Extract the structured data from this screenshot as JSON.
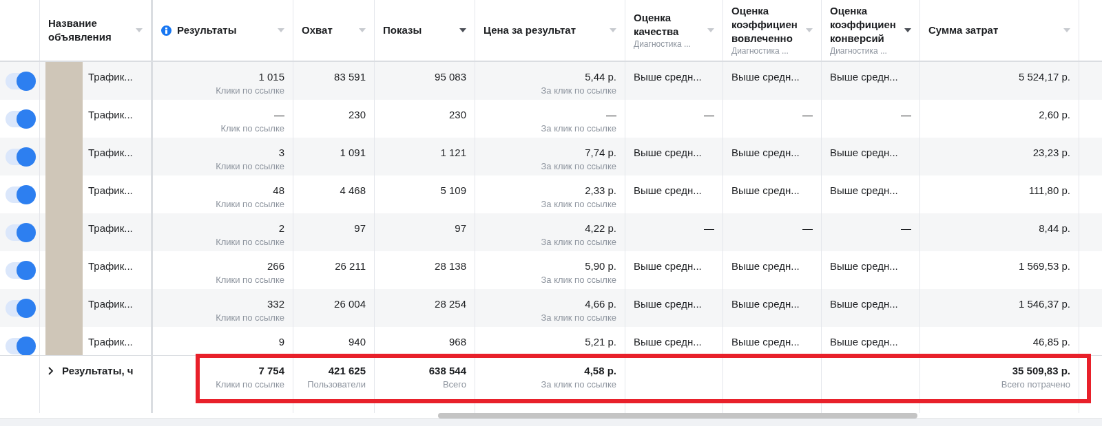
{
  "columns": [
    {
      "kind": "name",
      "title": "Название объявления",
      "sorted": false
    },
    {
      "kind": "results",
      "title": "Результаты",
      "info": true,
      "sorted": false
    },
    {
      "kind": "num",
      "title": "Охват",
      "sorted": false
    },
    {
      "kind": "num",
      "title": "Показы",
      "sorted": true
    },
    {
      "kind": "num",
      "title": "Цена за результат",
      "sorted": false
    },
    {
      "kind": "num",
      "title": "Оценка\nкачества",
      "subtitle": "Диагностика ...",
      "sorted": false
    },
    {
      "kind": "num",
      "title": "Оценка\nкоэффициен\nвовлеченно",
      "subtitle": "Диагностика ...",
      "sorted": false
    },
    {
      "kind": "num",
      "title": "Оценка\nкоэффициен\nконверсий",
      "subtitle": "Диагностика ...",
      "sorted": true
    },
    {
      "kind": "num",
      "title": "Сумма затрат",
      "sorted": false
    }
  ],
  "rows": [
    {
      "on": true,
      "name": "Трафик...",
      "results": {
        "value": "1 015",
        "label": "Клики по ссылке"
      },
      "reach": "83 591",
      "impressions": "95 083",
      "cpr": {
        "value": "5,44 р.",
        "label": "За клик по ссылке"
      },
      "quality": "Выше средн...",
      "engagement": "Выше средн...",
      "conversion": "Выше средн...",
      "spend": "5 524,17 р."
    },
    {
      "on": true,
      "name": "Трафик...",
      "results": {
        "value": "—",
        "label": "Клик по ссылке"
      },
      "reach": "230",
      "impressions": "230",
      "cpr": {
        "value": "—",
        "label": "За клик по ссылке"
      },
      "quality": "—",
      "engagement": "—",
      "conversion": "—",
      "spend": "2,60 р."
    },
    {
      "on": true,
      "name": "Трафик...",
      "results": {
        "value": "3",
        "label": "Клики по ссылке"
      },
      "reach": "1 091",
      "impressions": "1 121",
      "cpr": {
        "value": "7,74 р.",
        "label": "За клик по ссылке"
      },
      "quality": "Выше средн...",
      "engagement": "Выше средн...",
      "conversion": "Выше средн...",
      "spend": "23,23 р."
    },
    {
      "on": true,
      "name": "Трафик...",
      "results": {
        "value": "48",
        "label": "Клики по ссылке"
      },
      "reach": "4 468",
      "impressions": "5 109",
      "cpr": {
        "value": "2,33 р.",
        "label": "За клик по ссылке"
      },
      "quality": "Выше средн...",
      "engagement": "Выше средн...",
      "conversion": "Выше средн...",
      "spend": "111,80 р."
    },
    {
      "on": true,
      "name": "Трафик...",
      "results": {
        "value": "2",
        "label": "Клики по ссылке"
      },
      "reach": "97",
      "impressions": "97",
      "cpr": {
        "value": "4,22 р.",
        "label": "За клик по ссылке"
      },
      "quality": "—",
      "engagement": "—",
      "conversion": "—",
      "spend": "8,44 р."
    },
    {
      "on": true,
      "name": "Трафик...",
      "results": {
        "value": "266",
        "label": "Клики по ссылке"
      },
      "reach": "26 211",
      "impressions": "28 138",
      "cpr": {
        "value": "5,90 р.",
        "label": "За клик по ссылке"
      },
      "quality": "Выше средн...",
      "engagement": "Выше средн...",
      "conversion": "Выше средн...",
      "spend": "1 569,53 р."
    },
    {
      "on": true,
      "name": "Трафик...",
      "results": {
        "value": "332",
        "label": "Клики по ссылке"
      },
      "reach": "26 004",
      "impressions": "28 254",
      "cpr": {
        "value": "4,66 р.",
        "label": "За клик по ссылке"
      },
      "quality": "Выше средн...",
      "engagement": "Выше средн...",
      "conversion": "Выше средн...",
      "spend": "1 546,37 р."
    },
    {
      "on": true,
      "name": "Трафик...",
      "results": {
        "value": "9"
      },
      "reach": "940",
      "impressions": "968",
      "cpr": {
        "value": "5,21 р."
      },
      "quality": "Выше средн...",
      "engagement": "Выше средн...",
      "conversion": "Выше средн...",
      "spend": "46,85 р."
    }
  ],
  "totals": {
    "label": "Результаты, ч",
    "results": {
      "value": "7 754",
      "label": "Клики по ссылке"
    },
    "reach": {
      "value": "421 625",
      "label": "Пользователи"
    },
    "impressions": {
      "value": "638 544",
      "label": "Всего"
    },
    "cpr": {
      "value": "4,58 р.",
      "label": "За клик по ссылке"
    },
    "spend": {
      "value": "35 509,83 р.",
      "label": "Всего потрачено"
    }
  }
}
